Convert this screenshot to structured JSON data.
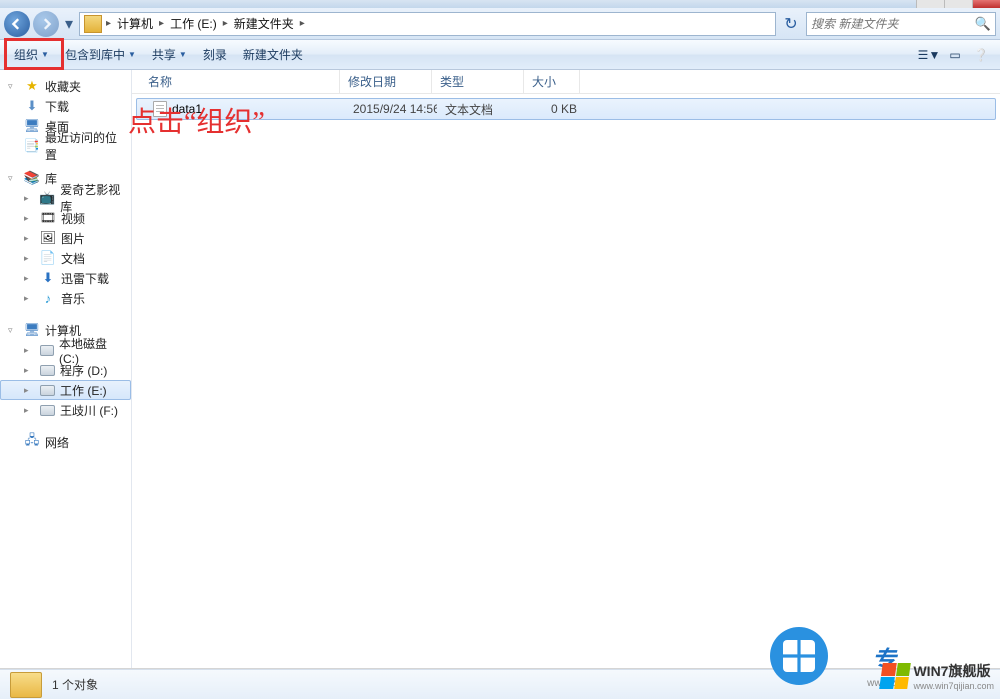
{
  "breadcrumbs": {
    "items": [
      "计算机",
      "工作 (E:)",
      "新建文件夹"
    ],
    "icon": "folder"
  },
  "search": {
    "placeholder": "搜索 新建文件夹"
  },
  "toolbar": {
    "organize": "组织",
    "include": "包含到库中",
    "share": "共享",
    "burn": "刻录",
    "newfolder": "新建文件夹"
  },
  "nav": {
    "favorites": {
      "label": "收藏夹",
      "items": [
        "下载",
        "桌面",
        "最近访问的位置"
      ]
    },
    "libraries": {
      "label": "库",
      "items": [
        "爱奇艺影视库",
        "视频",
        "图片",
        "文档",
        "迅雷下载",
        "音乐"
      ]
    },
    "computer": {
      "label": "计算机",
      "items": [
        "本地磁盘 (C:)",
        "程序 (D:)",
        "工作 (E:)",
        "王歧川 (F:)"
      ],
      "selected": 2
    },
    "network": {
      "label": "网络"
    }
  },
  "columns": {
    "name": "名称",
    "date": "修改日期",
    "type": "类型",
    "size": "大小"
  },
  "files": [
    {
      "name": "data1",
      "date": "2015/9/24 14:56",
      "type": "文本文档",
      "size": "0 KB"
    }
  ],
  "status": {
    "count": "1 个对象"
  },
  "annotation": "点击“组织”",
  "watermark": {
    "text1": "专",
    "url1": "www.z",
    "text2": "WIN7旗舰版",
    "url2": "www.win7qijian.com"
  }
}
